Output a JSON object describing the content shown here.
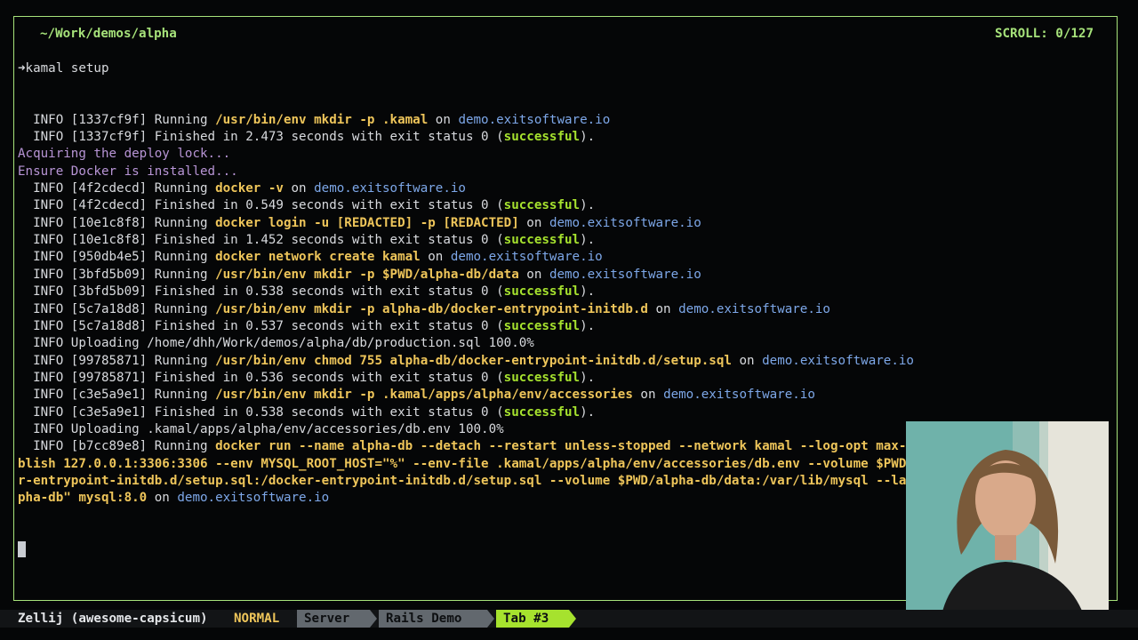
{
  "pane": {
    "title": "~/Work/demos/alpha",
    "scroll": "SCROLL:  0/127"
  },
  "prompt": {
    "command": "kamal setup"
  },
  "status_bar": {
    "session": "Zellij (awesome-capsicum)",
    "mode": "NORMAL",
    "tabs": [
      {
        "label": "Server"
      },
      {
        "label": "Rails Demo"
      },
      {
        "label": "Tab #3"
      }
    ]
  },
  "lines": [
    [
      {
        "t": "  INFO [1337cf9f] Running ",
        "c": "w"
      },
      {
        "t": "/usr/bin/env mkdir -p .kamal",
        "c": "y"
      },
      {
        "t": " on ",
        "c": "w"
      },
      {
        "t": "demo.exitsoftware.io",
        "c": "b"
      }
    ],
    [
      {
        "t": "  INFO [1337cf9f] Finished in 2.473 seconds with exit status 0 (",
        "c": "w"
      },
      {
        "t": "successful",
        "c": "g"
      },
      {
        "t": ").",
        "c": "w"
      }
    ],
    [
      {
        "t": "Acquiring the deploy lock...",
        "c": "p"
      }
    ],
    [
      {
        "t": "Ensure Docker is installed...",
        "c": "p"
      }
    ],
    [
      {
        "t": "  INFO [4f2cdecd] Running ",
        "c": "w"
      },
      {
        "t": "docker -v",
        "c": "y"
      },
      {
        "t": " on ",
        "c": "w"
      },
      {
        "t": "demo.exitsoftware.io",
        "c": "b"
      }
    ],
    [
      {
        "t": "  INFO [4f2cdecd] Finished in 0.549 seconds with exit status 0 (",
        "c": "w"
      },
      {
        "t": "successful",
        "c": "g"
      },
      {
        "t": ").",
        "c": "w"
      }
    ],
    [
      {
        "t": "  INFO [10e1c8f8] Running ",
        "c": "w"
      },
      {
        "t": "docker login -u [REDACTED] -p [REDACTED]",
        "c": "y"
      },
      {
        "t": " on ",
        "c": "w"
      },
      {
        "t": "demo.exitsoftware.io",
        "c": "b"
      }
    ],
    [
      {
        "t": "  INFO [10e1c8f8] Finished in 1.452 seconds with exit status 0 (",
        "c": "w"
      },
      {
        "t": "successful",
        "c": "g"
      },
      {
        "t": ").",
        "c": "w"
      }
    ],
    [
      {
        "t": "  INFO [950db4e5] Running ",
        "c": "w"
      },
      {
        "t": "docker network create kamal",
        "c": "y"
      },
      {
        "t": " on ",
        "c": "w"
      },
      {
        "t": "demo.exitsoftware.io",
        "c": "b"
      }
    ],
    [
      {
        "t": "  INFO [3bfd5b09] Running ",
        "c": "w"
      },
      {
        "t": "/usr/bin/env mkdir -p $PWD/alpha-db/data",
        "c": "y"
      },
      {
        "t": " on ",
        "c": "w"
      },
      {
        "t": "demo.exitsoftware.io",
        "c": "b"
      }
    ],
    [
      {
        "t": "  INFO [3bfd5b09] Finished in 0.538 seconds with exit status 0 (",
        "c": "w"
      },
      {
        "t": "successful",
        "c": "g"
      },
      {
        "t": ").",
        "c": "w"
      }
    ],
    [
      {
        "t": "  INFO [5c7a18d8] Running ",
        "c": "w"
      },
      {
        "t": "/usr/bin/env mkdir -p alpha-db/docker-entrypoint-initdb.d",
        "c": "y"
      },
      {
        "t": " on ",
        "c": "w"
      },
      {
        "t": "demo.exitsoftware.io",
        "c": "b"
      }
    ],
    [
      {
        "t": "  INFO [5c7a18d8] Finished in 0.537 seconds with exit status 0 (",
        "c": "w"
      },
      {
        "t": "successful",
        "c": "g"
      },
      {
        "t": ").",
        "c": "w"
      }
    ],
    [
      {
        "t": "  INFO Uploading /home/dhh/Work/demos/alpha/db/production.sql 100.0%",
        "c": "w"
      }
    ],
    [
      {
        "t": "  INFO [99785871] Running ",
        "c": "w"
      },
      {
        "t": "/usr/bin/env chmod 755 alpha-db/docker-entrypoint-initdb.d/setup.sql",
        "c": "y"
      },
      {
        "t": " on ",
        "c": "w"
      },
      {
        "t": "demo.exitsoftware.io",
        "c": "b"
      }
    ],
    [
      {
        "t": "  INFO [99785871] Finished in 0.536 seconds with exit status 0 (",
        "c": "w"
      },
      {
        "t": "successful",
        "c": "g"
      },
      {
        "t": ").",
        "c": "w"
      }
    ],
    [
      {
        "t": "  INFO [c3e5a9e1] Running ",
        "c": "w"
      },
      {
        "t": "/usr/bin/env mkdir -p .kamal/apps/alpha/env/accessories",
        "c": "y"
      },
      {
        "t": " on ",
        "c": "w"
      },
      {
        "t": "demo.exitsoftware.io",
        "c": "b"
      }
    ],
    [
      {
        "t": "  INFO [c3e5a9e1] Finished in 0.538 seconds with exit status 0 (",
        "c": "w"
      },
      {
        "t": "successful",
        "c": "g"
      },
      {
        "t": ").",
        "c": "w"
      }
    ],
    [
      {
        "t": "  INFO Uploading .kamal/apps/alpha/env/accessories/db.env 100.0%",
        "c": "w"
      }
    ],
    [
      {
        "t": "  INFO [b7cc89e8] Running ",
        "c": "w"
      },
      {
        "t": "docker run --name alpha-db --detach --restart unless-stopped --network kamal --log-opt max-size=\"10m\" --pu",
        "c": "y"
      }
    ],
    [
      {
        "t": "blish 127.0.0.1:3306:3306 --env MYSQL_ROOT_HOST=\"%\" --env-file .kamal/apps/alpha/env/accessories/db.env --volume $PWD/alpha-db/docke",
        "c": "y"
      }
    ],
    [
      {
        "t": "r-entrypoint-initdb.d/setup.sql:/docker-entrypoint-initdb.d/setup.sql --volume $PWD/alpha-db/data:/var/lib/mysql --label service=\"al",
        "c": "y"
      }
    ],
    [
      {
        "t": "pha-db\" mysql:8.0",
        "c": "y"
      },
      {
        "t": " on ",
        "c": "w"
      },
      {
        "t": "demo.exitsoftware.io",
        "c": "b"
      }
    ]
  ]
}
